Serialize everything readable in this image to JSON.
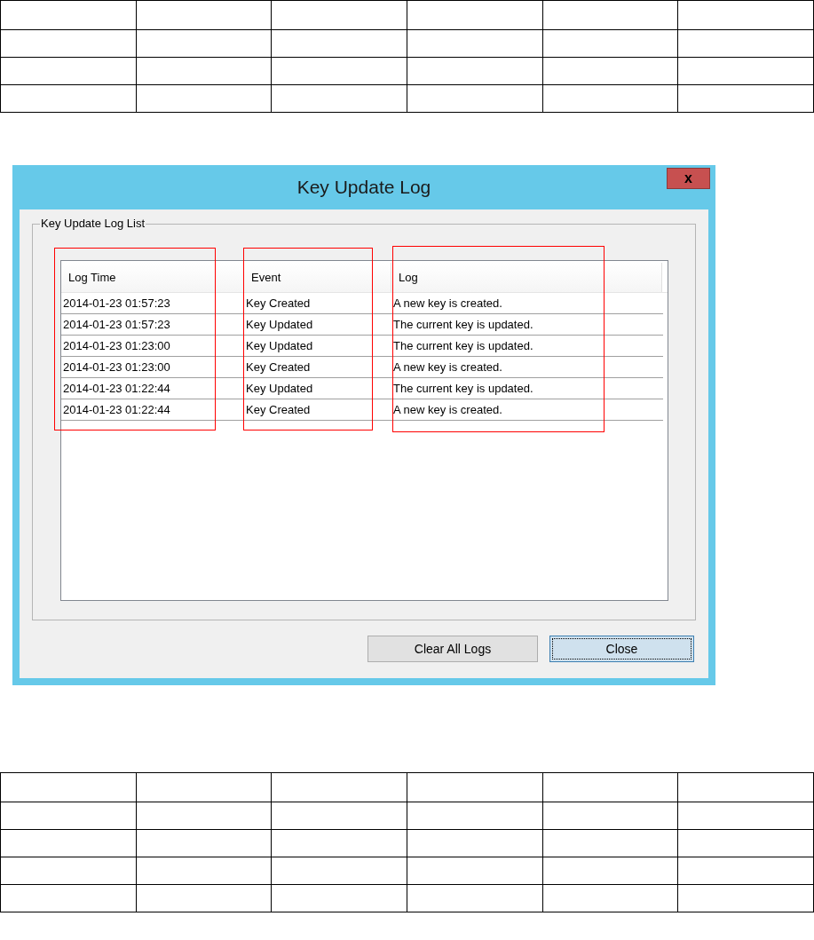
{
  "dialog": {
    "title": "Key Update Log",
    "close_label": "x",
    "group_label": "Key Update Log List",
    "columns": [
      {
        "label": "Log Time",
        "highlighted": true
      },
      {
        "label": "Event",
        "highlighted": true
      },
      {
        "label": "Log",
        "highlighted": true
      }
    ],
    "rows": [
      [
        "2014-01-23 01:57:23",
        "Key Created",
        "A new key is created."
      ],
      [
        "2014-01-23 01:57:23",
        "Key Updated",
        "The current key is updated."
      ],
      [
        "2014-01-23 01:23:00",
        "Key Updated",
        "The current key is updated."
      ],
      [
        "2014-01-23 01:23:00",
        "Key Created",
        "A new key is created."
      ],
      [
        "2014-01-23 01:22:44",
        "Key Updated",
        "The current key is updated."
      ],
      [
        "2014-01-23 01:22:44",
        "Key Created",
        "A new key is created."
      ]
    ],
    "buttons": [
      {
        "label": "Clear All Logs",
        "focused": false
      },
      {
        "label": "Close",
        "focused": true
      }
    ]
  }
}
